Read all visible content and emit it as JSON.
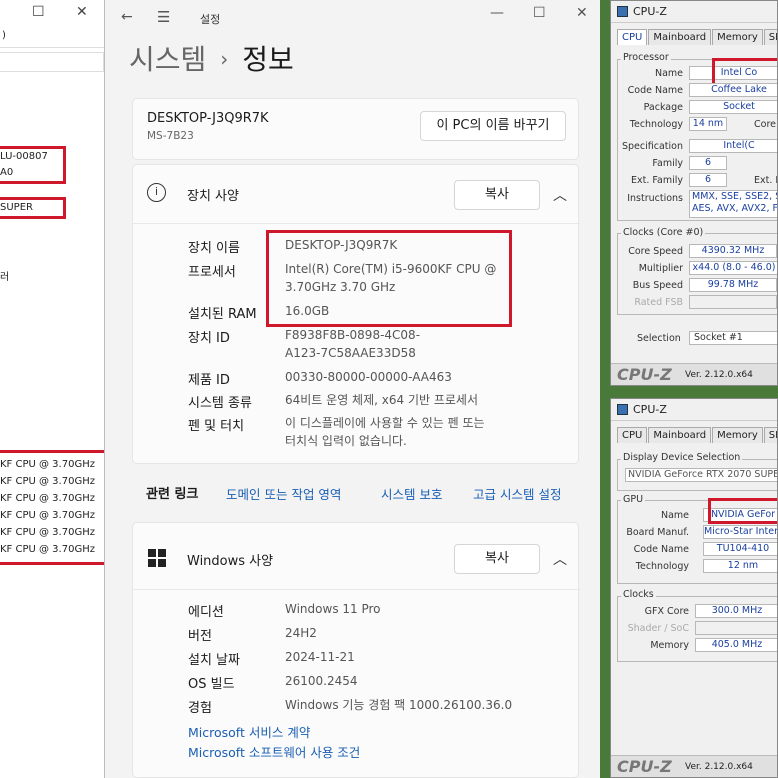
{
  "left_window": {
    "addr_fragment": ")",
    "lines": [
      {
        "text": "LU-00807"
      },
      {
        "text": "A0"
      },
      {
        "text": "SUPER"
      },
      {
        "text": "러"
      },
      {
        "text": "KF CPU @ 3.70GHz"
      },
      {
        "text": "KF CPU @ 3.70GHz"
      },
      {
        "text": "KF CPU @ 3.70GHz"
      },
      {
        "text": "KF CPU @ 3.70GHz"
      },
      {
        "text": "KF CPU @ 3.70GHz"
      },
      {
        "text": "KF CPU @ 3.70GHz"
      }
    ]
  },
  "settings": {
    "window_title": "설정",
    "breadcrumb_parent": "시스템",
    "breadcrumb_current": "정보",
    "pc_name": "DESKTOP-J3Q9R7K",
    "pc_model": "MS-7B23",
    "rename_button": "이 PC의 이름 바꾸기",
    "device_specs": {
      "title": "장치 사양",
      "copy_button": "복사",
      "rows": [
        {
          "label": "장치 이름",
          "value": "DESKTOP-J3Q9R7K"
        },
        {
          "label": "프로세서",
          "value": "Intel(R) Core(TM) i5-9600KF CPU @",
          "value2": "3.70GHz   3.70 GHz"
        },
        {
          "label": "설치된 RAM",
          "value": "16.0GB"
        },
        {
          "label": "장치 ID",
          "value": "F8938F8B-0898-4C08-",
          "value2": "A123-7C58AAE33D58"
        },
        {
          "label": "제품 ID",
          "value": "00330-80000-00000-AA463"
        },
        {
          "label": "시스템 종류",
          "value": "64비트 운영 체제, x64 기반 프로세서"
        },
        {
          "label": "펜 및 터치",
          "value": "이 디스플레이에 사용할 수 있는 펜 또는",
          "value2": "터치식 입력이 없습니다."
        }
      ]
    },
    "related_links": {
      "label": "관련 링크",
      "links": [
        "도메인 또는 작업 영역",
        "시스템 보호",
        "고급 시스템 설정"
      ]
    },
    "windows_specs": {
      "title": "Windows 사양",
      "copy_button": "복사",
      "rows": [
        {
          "label": "에디션",
          "value": "Windows 11 Pro"
        },
        {
          "label": "버전",
          "value": "24H2"
        },
        {
          "label": "설치 날짜",
          "value": "2024-11-21"
        },
        {
          "label": "OS 빌드",
          "value": "26100.2454"
        },
        {
          "label": "경험",
          "value": "Windows 기능 경험 팩 1000.26100.36.0"
        }
      ],
      "links": [
        "Microsoft 서비스 계약",
        "Microsoft 소프트웨어 사용 조건"
      ]
    }
  },
  "cpuz_cpu": {
    "title": "CPU-Z",
    "tabs": [
      "CPU",
      "Mainboard",
      "Memory",
      "SP"
    ],
    "processor_group": "Processor",
    "name_label": "Name",
    "name": "Intel Co",
    "codename_label": "Code Name",
    "codename": "Coffee Lake",
    "package_label": "Package",
    "package": "Socket",
    "technology_label": "Technology",
    "technology": "14 nm",
    "core_label": "Core",
    "spec_label": "Specification",
    "spec": "Intel(C",
    "family_label": "Family",
    "family": "6",
    "extfamily_label": "Ext. Family",
    "extfamily": "6",
    "extm_label": "Ext. I",
    "instr_label": "Instructions",
    "instr1": "MMX, SSE, SSE2, S",
    "instr2": "AES, AVX, AVX2, FM",
    "clocks_group": "Clocks (Core #0)",
    "corespeed_label": "Core Speed",
    "corespeed": "4390.32 MHz",
    "multiplier_label": "Multiplier",
    "multiplier": "x44.0 (8.0 - 46.0)",
    "busspeed_label": "Bus Speed",
    "busspeed": "99.78 MHz",
    "ratedfsb_label": "Rated FSB",
    "selection_label": "Selection",
    "selection": "Socket #1",
    "brand": "CPU-Z",
    "version": "Ver. 2.12.0.x64"
  },
  "cpuz_gpu": {
    "title": "CPU-Z",
    "tabs": [
      "CPU",
      "Mainboard",
      "Memory",
      "SP"
    ],
    "display_group": "Display Device Selection",
    "display": "NVIDIA GeForce RTX 2070 SUPER",
    "gpu_group": "GPU",
    "name_label": "Name",
    "name": "NVIDIA GeFor",
    "board_label": "Board Manuf.",
    "board": "Micro-Star Intern",
    "codename_label": "Code Name",
    "codename": "TU104-410",
    "tech_label": "Technology",
    "tech": "12 nm",
    "clocks_group": "Clocks",
    "gfx_label": "GFX Core",
    "gfx": "300.0 MHz",
    "shader_label": "Shader / SoC",
    "mem_label": "Memory",
    "mem": "405.0 MHz",
    "brand": "CPU-Z",
    "version": "Ver. 2.12.0.x64"
  },
  "colors": {
    "highlight_red": "#d0182d",
    "link_blue": "#1a5fb4",
    "cpuz_value_blue": "#1a3fa0"
  }
}
